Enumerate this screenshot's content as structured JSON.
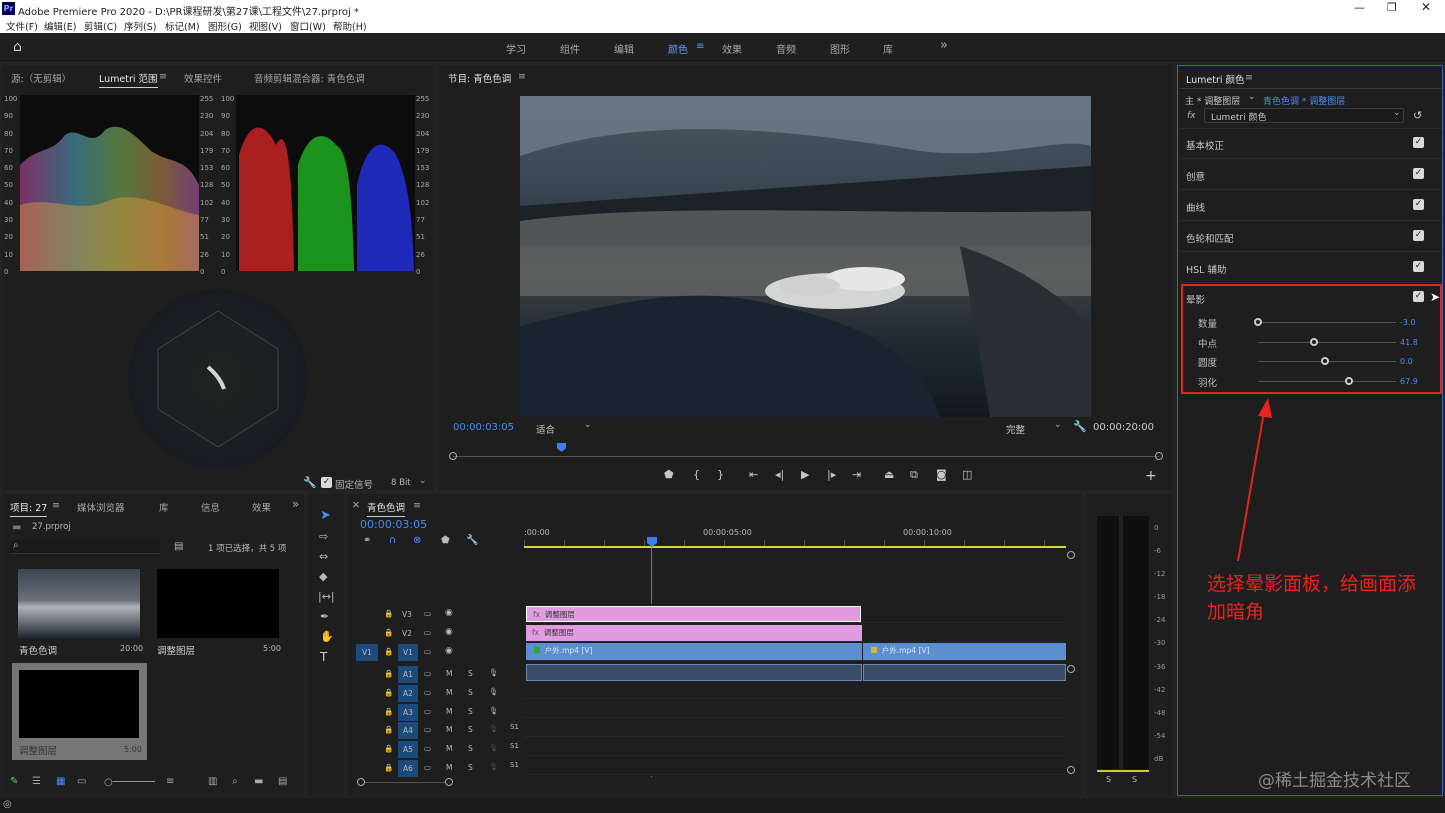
{
  "window": {
    "title": "Adobe Premiere Pro 2020 - D:\\PR课程研发\\第27课\\工程文件\\27.prproj *",
    "app_badge": "Pr"
  },
  "menu": [
    "文件(F)",
    "编辑(E)",
    "剪辑(C)",
    "序列(S)",
    "标记(M)",
    "图形(G)",
    "视图(V)",
    "窗口(W)",
    "帮助(H)"
  ],
  "workspaces": [
    "学习",
    "组件",
    "编辑",
    "颜色",
    "效果",
    "音频",
    "图形",
    "库"
  ],
  "workspace_active": "颜色",
  "more": "»",
  "source_panel": {
    "tabs": [
      "源:（无剪辑）",
      "Lumetri 范围",
      "效果控件",
      "音频剪辑混合器: 青色色调"
    ],
    "active": "Lumetri 范围",
    "left_axis": [
      "100",
      "90",
      "80",
      "70",
      "60",
      "50",
      "40",
      "30",
      "20",
      "10",
      "0"
    ],
    "mid_axis": [
      "255",
      "230",
      "204",
      "179",
      "153",
      "128",
      "102",
      "77",
      "51",
      "26",
      "0"
    ],
    "right_axis": [
      "100",
      "90",
      "80",
      "70",
      "60",
      "50",
      "40",
      "30",
      "20",
      "10",
      "0"
    ],
    "far_axis": [
      "255",
      "230",
      "204",
      "179",
      "153",
      "128",
      "102",
      "77",
      "51",
      "26",
      "0"
    ],
    "clamp_label": "固定信号",
    "bit_depth": "8 Bit"
  },
  "program": {
    "title": "节目: 青色色调",
    "timecode_in": "00:00:03:05",
    "fit": "适合",
    "quality": "完整",
    "timecode_out": "00:00:20:00"
  },
  "project": {
    "tabs": [
      "项目: 27",
      "媒体浏览器",
      "库",
      "信息",
      "效果"
    ],
    "file": "27.prproj",
    "selection": "1 项已选择，共 5 项",
    "items": [
      {
        "name": "青色色调",
        "dur": "20:00"
      },
      {
        "name": "调整图层",
        "dur": "5:00"
      },
      {
        "name": "调整图层",
        "dur": "5:00"
      }
    ]
  },
  "timeline": {
    "title": "青色色调",
    "timecode": "00:00:03:05",
    "ruler": [
      ":00:00",
      "00:00:05:00",
      "00:00:10:00"
    ],
    "video_tracks": [
      "V3",
      "V2",
      "V1"
    ],
    "audio_tracks": [
      "A1",
      "A2",
      "A3",
      "A4",
      "A5",
      "A6"
    ],
    "src_patch": "V1",
    "clips": {
      "v3": "调整图层",
      "v2": "调整图层",
      "v1a": "户外.mp4 [V]",
      "v1b": "户外.mp4 [V]"
    },
    "m": "M",
    "s": "S",
    "sub": "S1"
  },
  "meter": {
    "scale": [
      "0",
      "-6",
      "-12",
      "-18",
      "-24",
      "-30",
      "-36",
      "-42",
      "-48",
      "-54",
      "dB"
    ],
    "solo": [
      "S",
      "S"
    ]
  },
  "lumetri": {
    "title": "Lumetri 颜色",
    "master": "主 * 调整图层",
    "link": "青色色调 * 调整图层",
    "fx": "fx",
    "effect": "Lumetri 颜色",
    "sections": [
      "基本校正",
      "创意",
      "曲线",
      "色轮和匹配",
      "HSL 辅助",
      "晕影"
    ],
    "vignette": [
      {
        "label": "数量",
        "value": "-3.0",
        "pos": 0.0
      },
      {
        "label": "中点",
        "value": "41.8",
        "pos": 0.42
      },
      {
        "label": "圆度",
        "value": "0.0",
        "pos": 0.5
      },
      {
        "label": "羽化",
        "value": "67.9",
        "pos": 0.68
      }
    ]
  },
  "annotation": {
    "text1": "选择晕影面板，给画面添",
    "text2": "加暗角"
  },
  "watermark": "@稀土掘金技术社区"
}
